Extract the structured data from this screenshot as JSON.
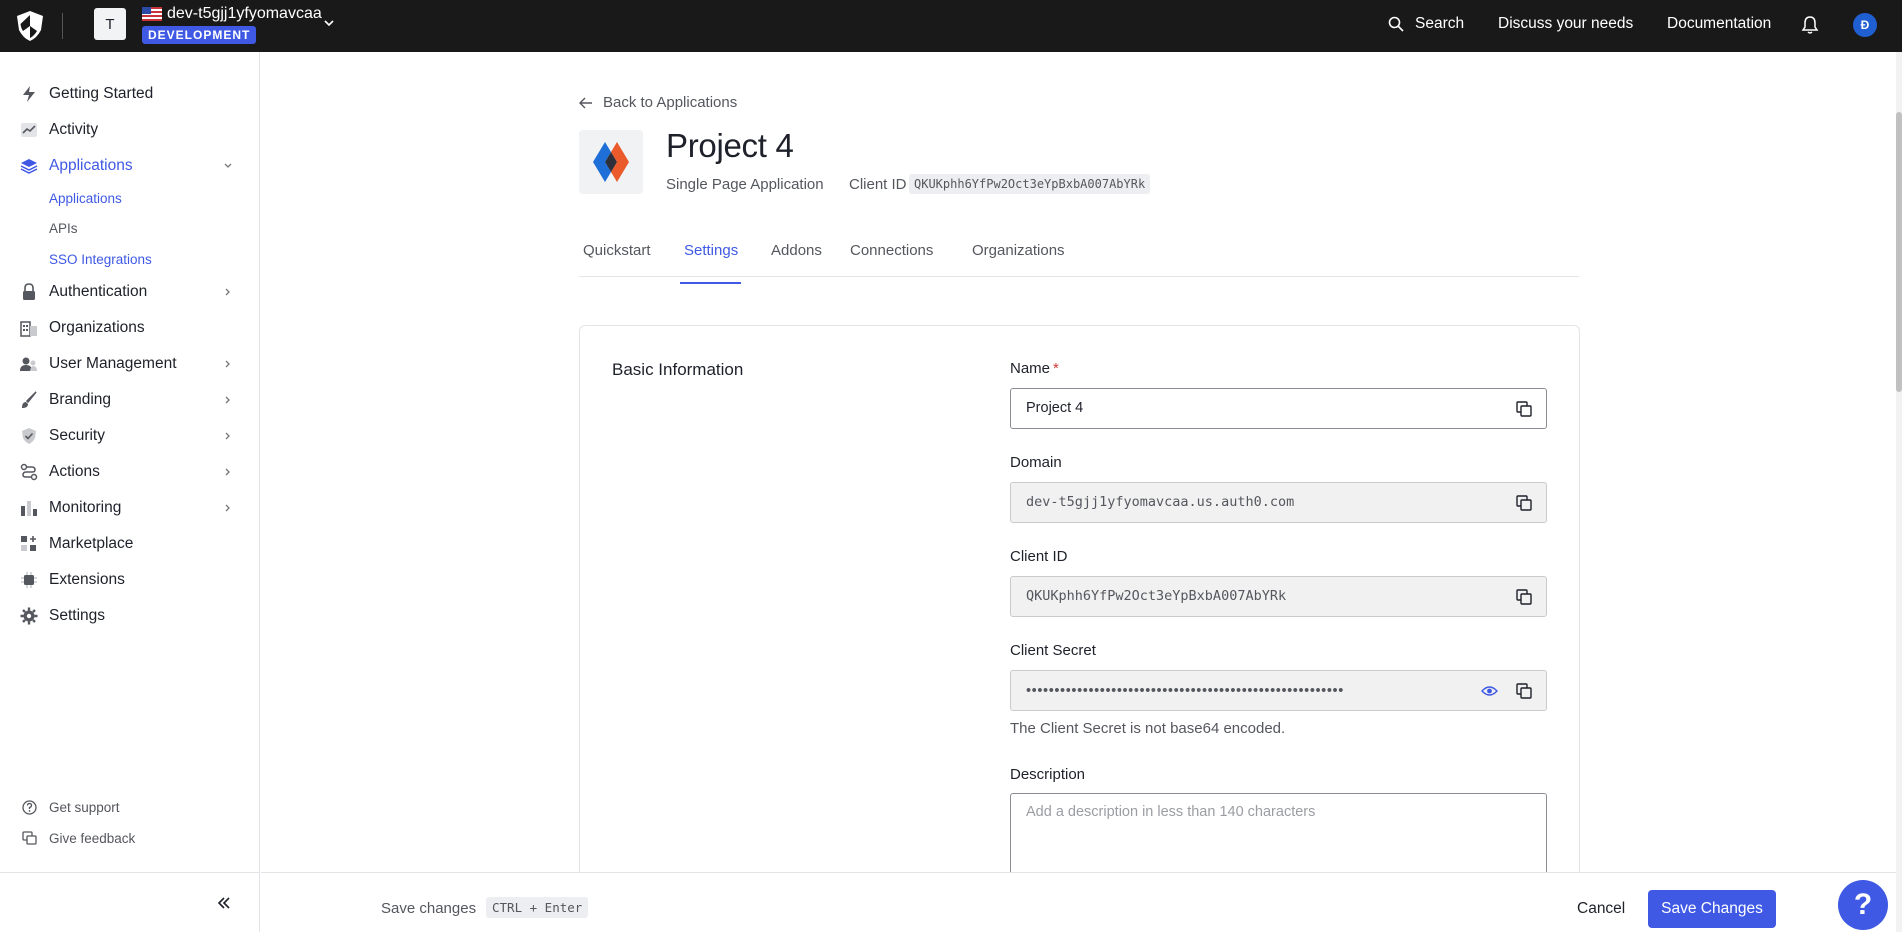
{
  "topbar": {
    "tenant_initial": "T",
    "tenant_name": "dev-t5gjj1yfyomavcaa",
    "tenant_env": "DEVELOPMENT",
    "search_label": "Search",
    "discuss_label": "Discuss your needs",
    "docs_label": "Documentation",
    "user_initial": "Đ"
  },
  "sidebar": {
    "items": [
      {
        "label": "Getting Started",
        "icon": "lightning-icon"
      },
      {
        "label": "Activity",
        "icon": "activity-chart-icon"
      },
      {
        "label": "Applications",
        "icon": "layers-icon"
      },
      {
        "label": "Authentication",
        "icon": "lock-icon"
      },
      {
        "label": "Organizations",
        "icon": "building-icon"
      },
      {
        "label": "User Management",
        "icon": "users-icon"
      },
      {
        "label": "Branding",
        "icon": "brush-icon"
      },
      {
        "label": "Security",
        "icon": "shield-check-icon"
      },
      {
        "label": "Actions",
        "icon": "actions-flow-icon"
      },
      {
        "label": "Monitoring",
        "icon": "bar-chart-icon"
      },
      {
        "label": "Marketplace",
        "icon": "grid-plus-icon"
      },
      {
        "label": "Extensions",
        "icon": "chip-icon"
      },
      {
        "label": "Settings",
        "icon": "gear-icon"
      }
    ],
    "sub_items": [
      "Applications",
      "APIs",
      "SSO Integrations"
    ],
    "footer": [
      {
        "label": "Get support",
        "icon": "question-circle-icon"
      },
      {
        "label": "Give feedback",
        "icon": "feedback-icon"
      }
    ]
  },
  "page": {
    "back_label": "Back to Applications",
    "title": "Project 4",
    "app_type": "Single Page Application",
    "client_id_label": "Client ID",
    "client_id": "QKUKphh6YfPw2Oct3eYpBxbA007AbYRk"
  },
  "tabs": [
    "Quickstart",
    "Settings",
    "Addons",
    "Connections",
    "Organizations"
  ],
  "form": {
    "section_title": "Basic Information",
    "name_label": "Name",
    "required_mark": "*",
    "name_value": "Project 4",
    "domain_label": "Domain",
    "domain_value": "dev-t5gjj1yfyomavcaa.us.auth0.com",
    "client_id_label": "Client ID",
    "client_id_value": "QKUKphh6YfPw2Oct3eYpBxbA007AbYRk",
    "secret_label": "Client Secret",
    "secret_value": "••••••••••••••••••••••••••••••••••••••••••••••••••••••••",
    "secret_hint": "The Client Secret is not base64 encoded.",
    "description_label": "Description",
    "description_placeholder": "Add a description in less than 140 characters"
  },
  "footer": {
    "save_hint": "Save changes",
    "shortcut": "CTRL + Enter",
    "cancel_label": "Cancel",
    "save_label": "Save Changes",
    "help_label": "?"
  },
  "colors": {
    "accent": "#3f59e4",
    "topbar": "#191919",
    "required": "#d03c38"
  }
}
